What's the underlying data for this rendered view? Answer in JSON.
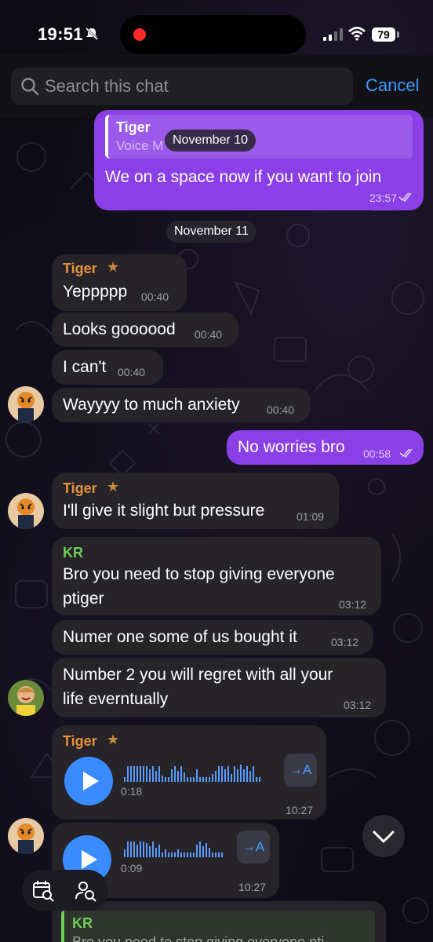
{
  "status_bar": {
    "time": "19:51",
    "battery": "79"
  },
  "search": {
    "placeholder": "Search this chat",
    "cancel_label": "Cancel"
  },
  "reply_preview": {
    "name": "Tiger",
    "text": "Voice M"
  },
  "date_separators": [
    "November 10",
    "November 11"
  ],
  "messages": [
    {
      "text": "We on a space now if you want to join",
      "time": "23:57"
    },
    {
      "sender": "Tiger",
      "text": "Yeppppp",
      "time": "00:40"
    },
    {
      "text": "Looks goooood",
      "time": "00:40"
    },
    {
      "text": "I can't",
      "time": "00:40"
    },
    {
      "text": "Wayyyy to much anxiety",
      "time": "00:40"
    },
    {
      "text": "No worries bro",
      "time": "00:58"
    },
    {
      "sender": "Tiger",
      "text": "I'll give it slight but pressure",
      "time": "01:09"
    },
    {
      "sender": "KR",
      "line1": "Bro you need to stop giving everyone",
      "line2": "ptiger",
      "time": "03:12"
    },
    {
      "text": "Numer one some of us bought it",
      "time": "03:12"
    },
    {
      "line1": "Number 2 you will  regret with all your",
      "line2": "life everntually",
      "time": "03:12"
    },
    {
      "sender": "Tiger",
      "duration": "0:18",
      "time": "10:27",
      "transcribe": "→A"
    },
    {
      "duration": "0:09",
      "time": "10:27",
      "transcribe": "→A"
    }
  ],
  "partial_reply": {
    "name": "KR",
    "text": "Bro you need to stop giving everyone pti"
  },
  "colors": {
    "outgoing": "#8b3fe6",
    "incoming": "#262429",
    "tiger_name": "#e8923a",
    "kr_name": "#6fcf56",
    "accent": "#3a8bff"
  },
  "icons": [
    "bell-slash-icon",
    "signal-icon",
    "wifi-icon",
    "search-icon",
    "read-checks-icon",
    "star-icon",
    "play-icon",
    "chevron-down-icon",
    "calendar-search-icon",
    "user-search-icon"
  ]
}
